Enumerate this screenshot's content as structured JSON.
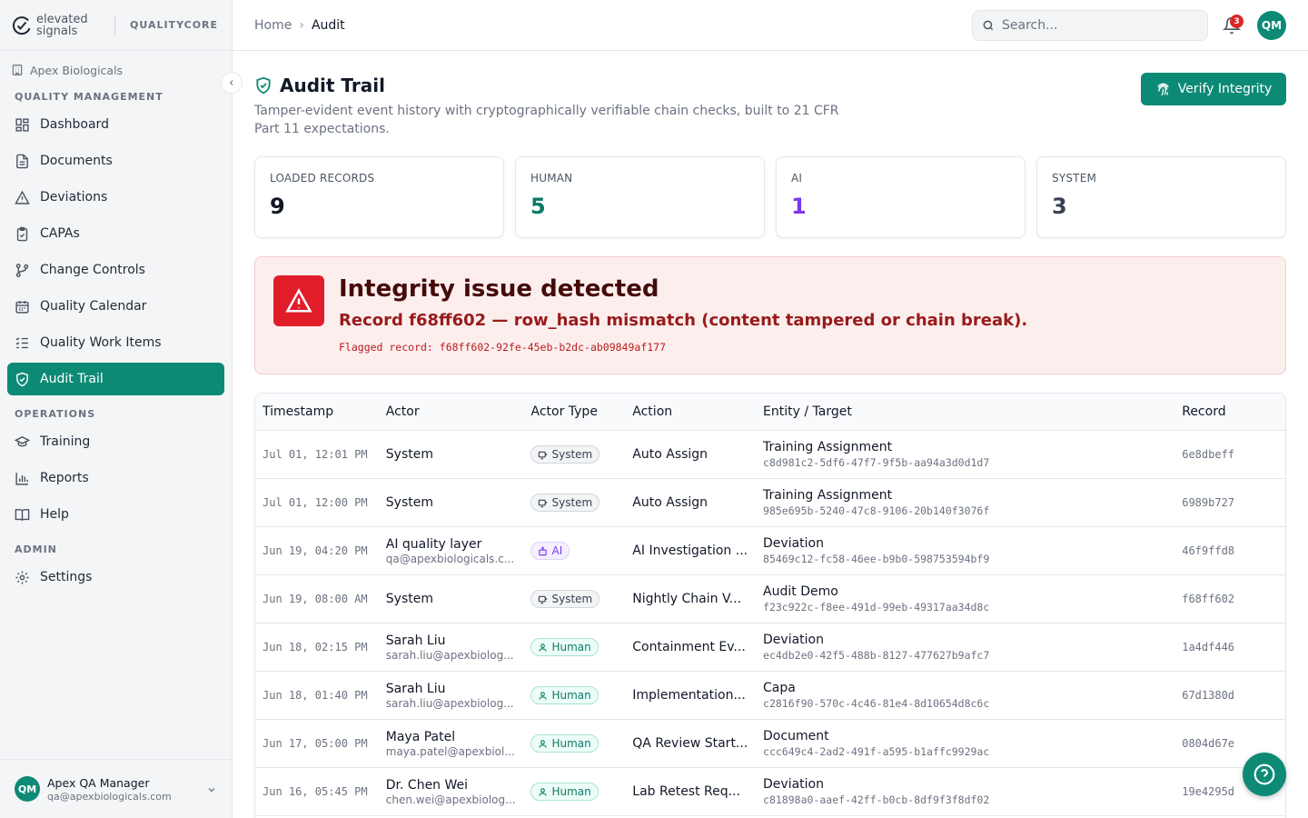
{
  "brand": {
    "name": "elevated signals",
    "product": "QUALITYCORE"
  },
  "org": "Apex Biologicals",
  "sidebar": {
    "quality_title": "QUALITY MANAGEMENT",
    "quality_items": [
      {
        "label": "Dashboard",
        "icon": "dashboard-icon"
      },
      {
        "label": "Documents",
        "icon": "document-icon"
      },
      {
        "label": "Deviations",
        "icon": "warning-icon"
      },
      {
        "label": "CAPAs",
        "icon": "clipboard-check-icon"
      },
      {
        "label": "Change Controls",
        "icon": "git-branch-icon"
      },
      {
        "label": "Quality Calendar",
        "icon": "calendar-icon"
      },
      {
        "label": "Quality Work Items",
        "icon": "list-check-icon"
      },
      {
        "label": "Audit Trail",
        "icon": "shield-check-icon",
        "active": true
      }
    ],
    "operations_title": "OPERATIONS",
    "operations_items": [
      {
        "label": "Training",
        "icon": "graduation-cap-icon"
      },
      {
        "label": "Reports",
        "icon": "bar-chart-icon"
      },
      {
        "label": "Help",
        "icon": "book-open-icon"
      }
    ],
    "admin_title": "ADMIN",
    "admin_items": [
      {
        "label": "Settings",
        "icon": "gear-icon"
      }
    ],
    "user": {
      "initials": "QM",
      "name": "Apex QA Manager",
      "email": "qa@apexbiologicals.com"
    }
  },
  "header": {
    "breadcrumb_home": "Home",
    "breadcrumb_current": "Audit",
    "search_placeholder": "Search...",
    "notification_count": "3",
    "avatar_initials": "QM"
  },
  "page": {
    "title": "Audit Trail",
    "subtitle": "Tamper-evident event history with cryptographically verifiable chain checks, built to 21 CFR Part 11 expectations.",
    "verify_button": "Verify Integrity"
  },
  "stats": [
    {
      "label": "LOADED RECORDS",
      "value": "9",
      "color": "#111827"
    },
    {
      "label": "HUMAN",
      "value": "5",
      "color": "#0d7a68"
    },
    {
      "label": "AI",
      "value": "1",
      "color": "#7c3aed"
    },
    {
      "label": "SYSTEM",
      "value": "3",
      "color": "#374151"
    }
  ],
  "alert": {
    "title": "Integrity issue detected",
    "message": "Record f68ff602 — row_hash mismatch (content tampered or chain break).",
    "flagged": "Flagged record: f68ff602-92fe-45eb-b2dc-ab09849af177"
  },
  "table": {
    "headers": [
      "Timestamp",
      "Actor",
      "Actor Type",
      "Action",
      "Entity / Target",
      "Record"
    ],
    "rows": [
      {
        "ts": "Jul 01, 12:01 PM",
        "actor": "System",
        "actor_email": "",
        "type": "System",
        "action": "Auto Assign",
        "entity": "Training Assignment",
        "entity_id": "c8d981c2-5df6-47f7-9f5b-aa94a3d0d1d7",
        "record": "6e8dbeff"
      },
      {
        "ts": "Jul 01, 12:00 PM",
        "actor": "System",
        "actor_email": "",
        "type": "System",
        "action": "Auto Assign",
        "entity": "Training Assignment",
        "entity_id": "985e695b-5240-47c8-9106-20b140f3076f",
        "record": "6989b727"
      },
      {
        "ts": "Jun 19, 04:20 PM",
        "actor": "AI quality layer",
        "actor_email": "qa@apexbiologicals.c...",
        "type": "AI",
        "action": "AI Investigation ...",
        "entity": "Deviation",
        "entity_id": "85469c12-fc58-46ee-b9b0-598753594bf9",
        "record": "46f9ffd8"
      },
      {
        "ts": "Jun 19, 08:00 AM",
        "actor": "System",
        "actor_email": "",
        "type": "System",
        "action": "Nightly Chain V...",
        "entity": "Audit Demo",
        "entity_id": "f23c922c-f8ee-491d-99eb-49317aa34d8c",
        "record": "f68ff602"
      },
      {
        "ts": "Jun 18, 02:15 PM",
        "actor": "Sarah Liu",
        "actor_email": "sarah.liu@apexbiolog...",
        "type": "Human",
        "action": "Containment Ev...",
        "entity": "Deviation",
        "entity_id": "ec4db2e0-42f5-488b-8127-477627b9afc7",
        "record": "1a4df446"
      },
      {
        "ts": "Jun 18, 01:40 PM",
        "actor": "Sarah Liu",
        "actor_email": "sarah.liu@apexbiolog...",
        "type": "Human",
        "action": "Implementation...",
        "entity": "Capa",
        "entity_id": "c2816f90-570c-4c46-81e4-8d10654d8c6c",
        "record": "67d1380d"
      },
      {
        "ts": "Jun 17, 05:00 PM",
        "actor": "Maya Patel",
        "actor_email": "maya.patel@apexbiol...",
        "type": "Human",
        "action": "QA Review Start...",
        "entity": "Document",
        "entity_id": "ccc649c4-2ad2-491f-a595-b1affc9929ac",
        "record": "0804d67e"
      },
      {
        "ts": "Jun 16, 05:45 PM",
        "actor": "Dr. Chen Wei",
        "actor_email": "chen.wei@apexbiolog...",
        "type": "Human",
        "action": "Lab Retest Req...",
        "entity": "Deviation",
        "entity_id": "c81898a0-aaef-42ff-b0cb-8df9f3f8df02",
        "record": "19e4295d"
      }
    ]
  },
  "colors": {
    "accent": "#0d8a76",
    "danger": "#e11d2a"
  }
}
